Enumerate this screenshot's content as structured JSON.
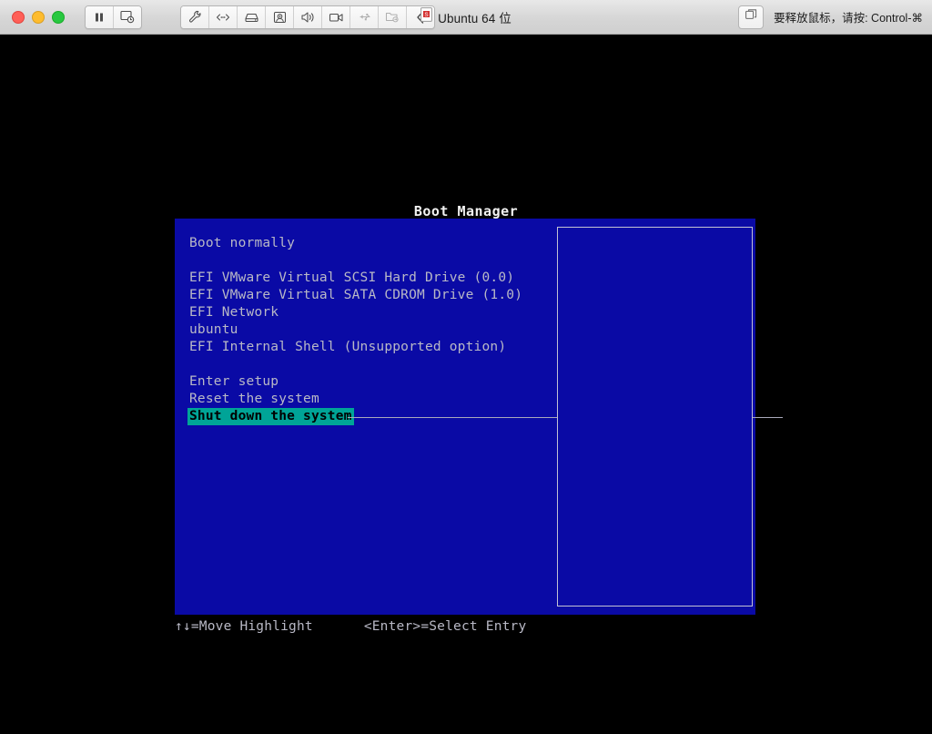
{
  "window": {
    "traffic_lights": [
      {
        "name": "close",
        "color": "#ff5f57"
      },
      {
        "name": "minimize",
        "color": "#febc2e"
      },
      {
        "name": "maximize",
        "color": "#28c840"
      }
    ],
    "title": "Ubuntu 64 位",
    "title_icon": "vm-document-icon",
    "release_mouse_hint": "要释放鼠标，请按: Control-⌘",
    "release_mouse_icon": "unity-window-icon"
  },
  "toolbar": {
    "group_playback": [
      {
        "name": "pause-button",
        "icon": "pause-icon",
        "label": ""
      },
      {
        "name": "snapshot-button",
        "icon": "snapshot-icon",
        "label": ""
      }
    ],
    "group_devices": [
      {
        "name": "settings-button",
        "icon": "wrench-icon",
        "label": ""
      },
      {
        "name": "network-button",
        "icon": "network-icon",
        "label": ""
      },
      {
        "name": "harddisk-button",
        "icon": "hard-disk-icon",
        "label": ""
      },
      {
        "name": "camera-button",
        "icon": "webcam-icon",
        "label": ""
      },
      {
        "name": "sound-button",
        "icon": "speaker-icon",
        "label": ""
      },
      {
        "name": "display-button",
        "icon": "video-camera-icon",
        "label": ""
      },
      {
        "name": "usb-button",
        "icon": "usb-icon",
        "label": ""
      },
      {
        "name": "sharedfolder-button",
        "icon": "shared-folder-icon",
        "label": ""
      },
      {
        "name": "collapse-button",
        "icon": "chevron-left-icon",
        "label": ""
      }
    ]
  },
  "bios": {
    "title": "Boot Manager",
    "background_color": "#0a0aa5",
    "text_color": "#b9b9c6",
    "highlight_bg": "#00a497",
    "highlight_fg": "#000000",
    "menu": [
      {
        "label": "Boot normally",
        "selected": false,
        "spacer": false
      },
      {
        "label": "",
        "selected": false,
        "spacer": true
      },
      {
        "label": "EFI VMware Virtual SCSI Hard Drive (0.0)",
        "selected": false,
        "spacer": false
      },
      {
        "label": "EFI VMware Virtual SATA CDROM Drive (1.0)",
        "selected": false,
        "spacer": false
      },
      {
        "label": "EFI Network",
        "selected": false,
        "spacer": false
      },
      {
        "label": "ubuntu",
        "selected": false,
        "spacer": false
      },
      {
        "label": "EFI Internal Shell (Unsupported option)",
        "selected": false,
        "spacer": false
      },
      {
        "label": "",
        "selected": false,
        "spacer": true
      },
      {
        "label": "Enter setup",
        "selected": false,
        "spacer": false
      },
      {
        "label": "Reset the system",
        "selected": false,
        "spacer": false
      },
      {
        "label": "Shut down the system",
        "selected": true,
        "spacer": false
      }
    ],
    "info_panel_text": "",
    "footer": {
      "move_hint": "↑↓=Move Highlight",
      "select_hint": "<Enter>=Select Entry"
    }
  }
}
